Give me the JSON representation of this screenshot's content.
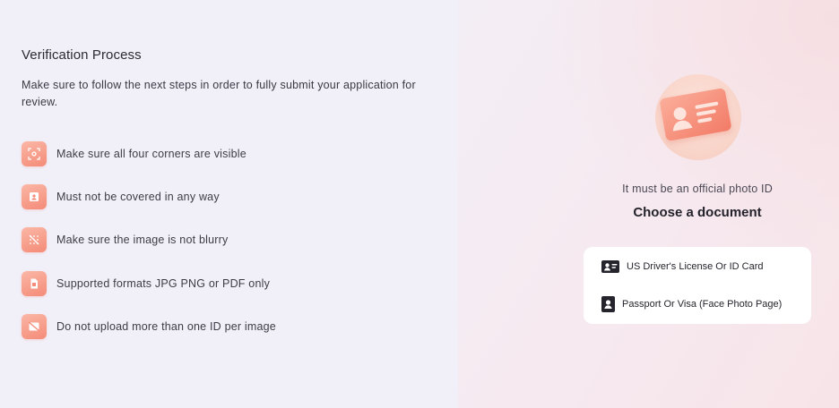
{
  "verification": {
    "title": "Verification Process",
    "description": "Make sure to follow the next steps in order to fully submit your application for review.",
    "steps": [
      {
        "label": "Make sure all four corners are visible",
        "icon": "corners-focus-icon"
      },
      {
        "label": "Must not be covered in any way",
        "icon": "id-badge-icon"
      },
      {
        "label": "Make sure the image is not blurry",
        "icon": "blur-off-icon"
      },
      {
        "label": "Supported formats JPG PNG or PDF only",
        "icon": "file-icon"
      },
      {
        "label": "Do not upload more than one ID per image",
        "icon": "image-off-icon"
      }
    ]
  },
  "document": {
    "subtitle": "It must be an official photo ID",
    "heading": "Choose a document",
    "options": [
      {
        "label": "US Driver's License Or ID Card",
        "icon": "id-card-icon"
      },
      {
        "label": "Passport Or Visa (Face Photo Page)",
        "icon": "passport-icon"
      }
    ]
  },
  "colors": {
    "accent": "#f48b78",
    "accent_light": "#fbb7a6",
    "panel_bg": "#ffffff",
    "left_bg": "#f1eff8"
  }
}
